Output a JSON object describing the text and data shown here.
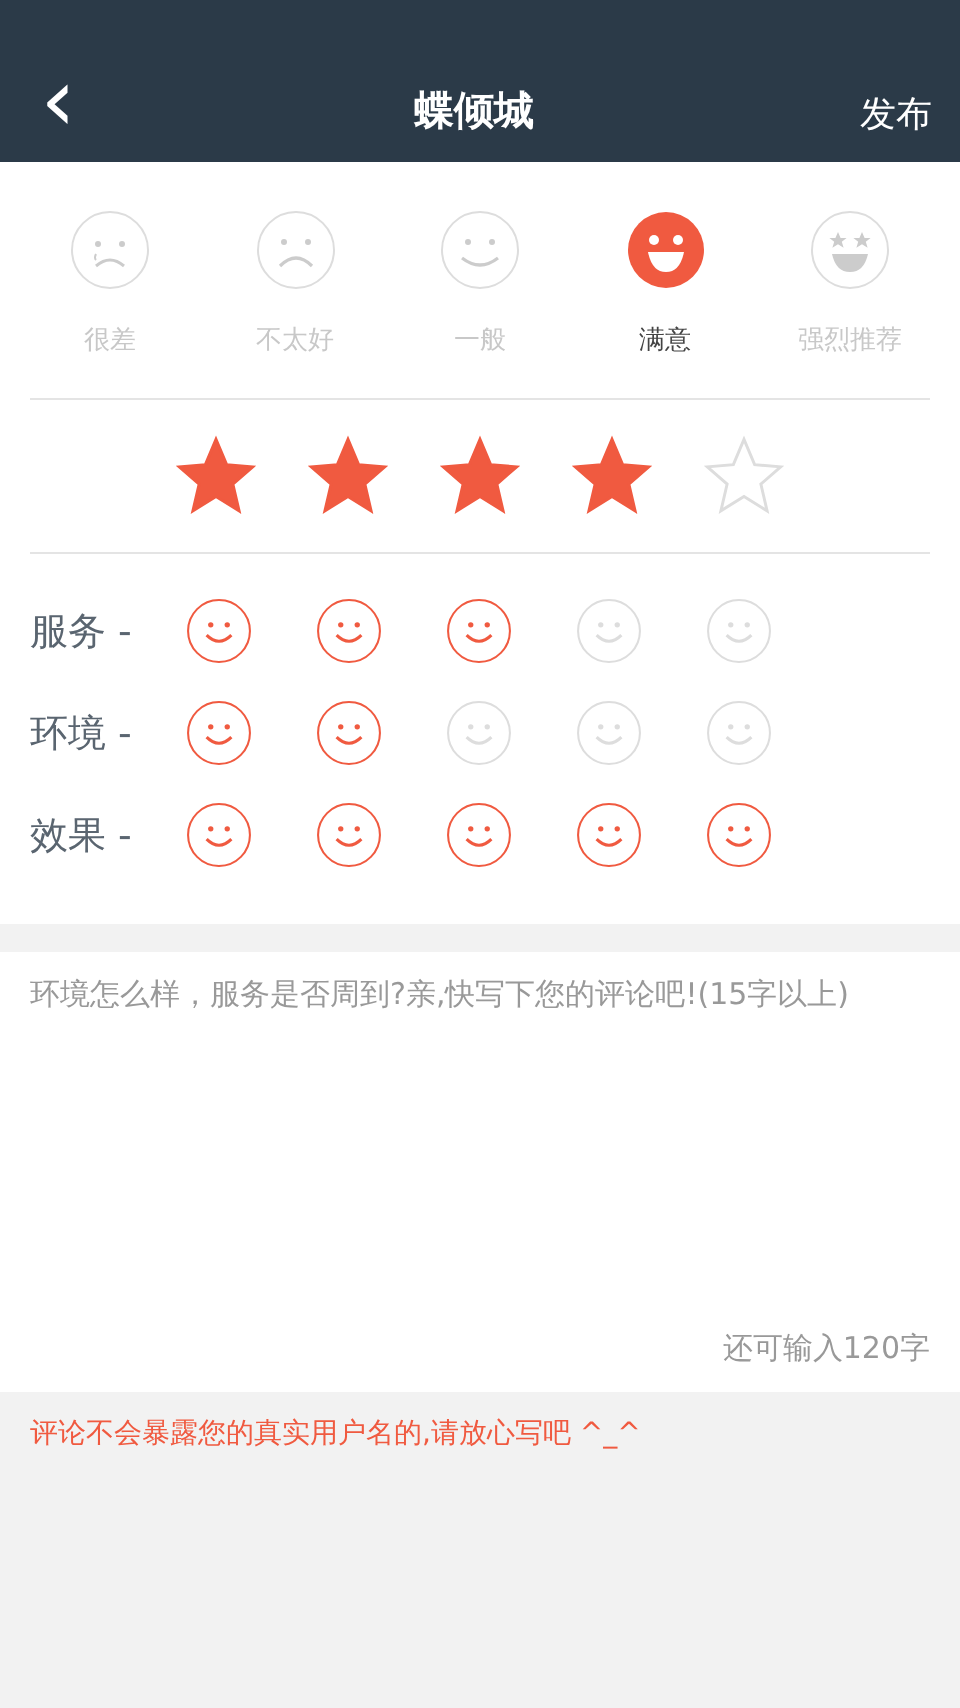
{
  "header": {
    "back_label": "‹",
    "title": "蝶倾城",
    "action": "发布"
  },
  "moods": [
    {
      "kind": "cry",
      "label": "很差",
      "selected": false
    },
    {
      "kind": "sad",
      "label": "不太好",
      "selected": false
    },
    {
      "kind": "smile",
      "label": "一般",
      "selected": false
    },
    {
      "kind": "grin",
      "label": "满意",
      "selected": true
    },
    {
      "kind": "starry",
      "label": "强烈推荐",
      "selected": false
    }
  ],
  "rating": {
    "stars": 4
  },
  "categories": [
    {
      "label": "服务 -",
      "faces": [
        {
          "selected": true
        },
        {
          "selected": true
        },
        {
          "selected": true
        },
        {
          "selected": false
        },
        {
          "selected": false
        }
      ]
    },
    {
      "label": "环境 -",
      "faces": [
        {
          "selected": true
        },
        {
          "selected": true
        },
        {
          "selected": false
        },
        {
          "selected": false
        },
        {
          "selected": false
        }
      ]
    },
    {
      "label": "效果 -",
      "faces": [
        {
          "selected": true
        },
        {
          "selected": true
        },
        {
          "selected": true
        },
        {
          "selected": true
        },
        {
          "selected": true
        }
      ]
    }
  ],
  "comment": {
    "placeholder": "环境怎么样，服务是否周到?亲,快写下您的评论吧!(15字以上)",
    "counter": "还可输入120字"
  },
  "note": "评论不会暴露您的真实用户名的,请放心写吧 ^_^"
}
